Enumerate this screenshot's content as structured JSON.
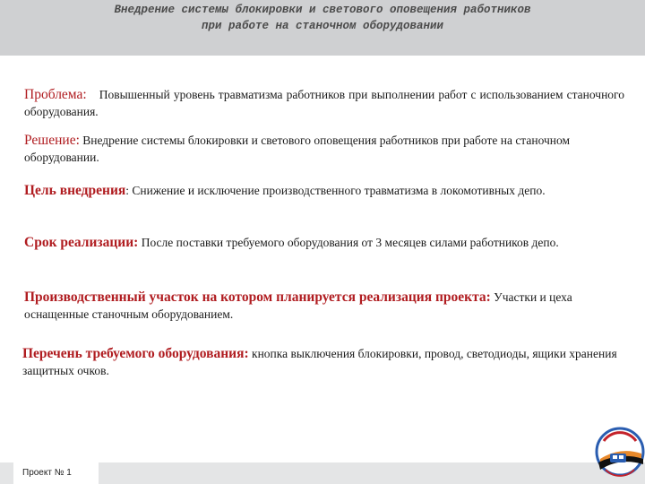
{
  "header": {
    "line1": "Внедрение системы блокировки и светового оповещения работников",
    "line2": "при работе на станочном оборудовании"
  },
  "items": [
    {
      "label": "Проблема:",
      "text": "Повышенный уровень травматизма работников при выполнении работ с использованием станочного оборудования."
    },
    {
      "label": "Решение:",
      "text": "Внедрение системы блокировки и светового оповещения работников при работе на станочном оборудовании."
    },
    {
      "label": "Цель внедрения",
      "text": ": Снижение и исключение производственного травматизма в локомотивных депо."
    },
    {
      "label": "Срок реализации:",
      "text": "После поставки требуемого оборудования  от 3 месяцев силами работников депо."
    },
    {
      "label": "Производственный участок на котором планируется реализация проекта:",
      "text": "Участки и цеха оснащенные станочным оборудованием."
    },
    {
      "label": "Перечень требуемого оборудования:",
      "text": "кнопка выключения блокировки, провод, светодиоды, ящики хранения защитных очков."
    }
  ],
  "footer": {
    "project": "Проект № 1"
  },
  "logo": {
    "icon": "railway-logo-icon",
    "colors": {
      "blue": "#2a5db0",
      "red": "#c4232b",
      "orange": "#e8892b",
      "black": "#111111"
    }
  }
}
